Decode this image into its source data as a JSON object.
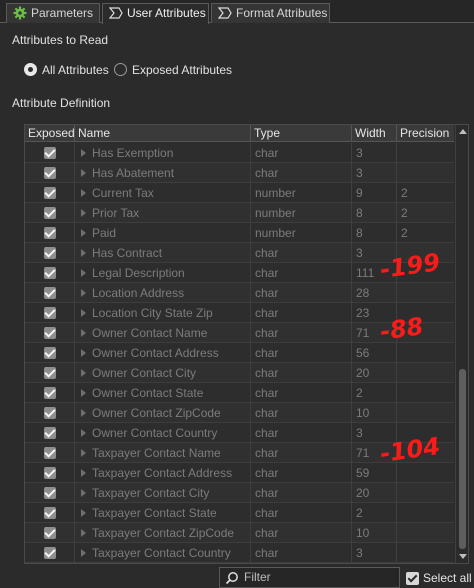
{
  "tabs": [
    {
      "label": "Parameters",
      "icon": "gear-icon"
    },
    {
      "label": "User Attributes",
      "icon": "sigma-icon"
    },
    {
      "label": "Format Attributes",
      "icon": "sigma-icon"
    }
  ],
  "read_section": {
    "title": "Attributes to Read",
    "options": [
      "All Attributes",
      "Exposed Attributes"
    ],
    "selected": "All Attributes"
  },
  "definition": {
    "title": "Attribute Definition",
    "columns": [
      "Exposed",
      "Name",
      "Type",
      "Width",
      "Precision"
    ],
    "rows": [
      {
        "name": "Has Exemption",
        "type": "char",
        "width": "3",
        "precision": ""
      },
      {
        "name": "Has Abatement",
        "type": "char",
        "width": "3",
        "precision": ""
      },
      {
        "name": "Current Tax",
        "type": "number",
        "width": "9",
        "precision": "2"
      },
      {
        "name": "Prior Tax",
        "type": "number",
        "width": "8",
        "precision": "2"
      },
      {
        "name": "Paid",
        "type": "number",
        "width": "8",
        "precision": "2"
      },
      {
        "name": "Has Contract",
        "type": "char",
        "width": "3",
        "precision": ""
      },
      {
        "name": "Legal Description",
        "type": "char",
        "width": "111",
        "precision": ""
      },
      {
        "name": "Location Address",
        "type": "char",
        "width": "28",
        "precision": ""
      },
      {
        "name": "Location City State Zip",
        "type": "char",
        "width": "23",
        "precision": ""
      },
      {
        "name": "Owner Contact Name",
        "type": "char",
        "width": "71",
        "precision": ""
      },
      {
        "name": "Owner Contact Address",
        "type": "char",
        "width": "56",
        "precision": ""
      },
      {
        "name": "Owner Contact City",
        "type": "char",
        "width": "20",
        "precision": ""
      },
      {
        "name": "Owner Contact State",
        "type": "char",
        "width": "2",
        "precision": ""
      },
      {
        "name": "Owner Contact ZipCode",
        "type": "char",
        "width": "10",
        "precision": ""
      },
      {
        "name": "Owner Contact Country",
        "type": "char",
        "width": "3",
        "precision": ""
      },
      {
        "name": "Taxpayer Contact Name",
        "type": "char",
        "width": "71",
        "precision": ""
      },
      {
        "name": "Taxpayer Contact Address",
        "type": "char",
        "width": "59",
        "precision": ""
      },
      {
        "name": "Taxpayer Contact City",
        "type": "char",
        "width": "20",
        "precision": ""
      },
      {
        "name": "Taxpayer Contact State",
        "type": "char",
        "width": "2",
        "precision": ""
      },
      {
        "name": "Taxpayer Contact ZipCode",
        "type": "char",
        "width": "10",
        "precision": ""
      },
      {
        "name": "Taxpayer Contact Country",
        "type": "char",
        "width": "3",
        "precision": ""
      }
    ]
  },
  "annotations": [
    "-199",
    "-88",
    "-104"
  ],
  "filter": {
    "placeholder": "Filter",
    "value": ""
  },
  "select_all": {
    "label": "Select all",
    "checked": true
  },
  "colors": {
    "annotation": "#ff1a1a",
    "background": "#2b2b2b",
    "checkbox": "#8e8e8e"
  }
}
